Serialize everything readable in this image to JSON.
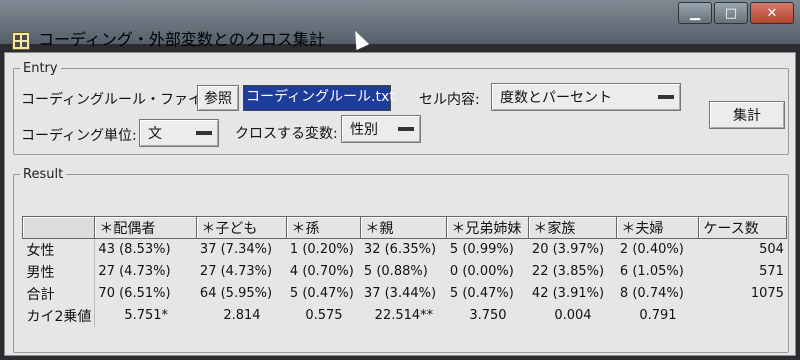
{
  "window": {
    "title": "コーディング・外部変数とのクロス集計",
    "controls": {
      "minimize": "▁",
      "maximize": "□",
      "close": "✕"
    }
  },
  "entry": {
    "legend": "Entry",
    "coding_file_label": "コーディングルール・ファイル:",
    "browse_button": "参照",
    "coding_file_value": "コーディングルール.txt",
    "cell_content_label": "セル内容:",
    "cell_content_value": "度数とパーセント",
    "unit_label": "コーディング単位:",
    "unit_value": "文",
    "cross_var_label": "クロスする変数:",
    "cross_var_value": "性別",
    "aggregate_button": "集計"
  },
  "result": {
    "legend": "Result",
    "columns": [
      "＊配偶者",
      "＊子ども",
      "＊孫",
      "＊親",
      "＊兄弟姉妹",
      "＊家族",
      "＊夫婦",
      "ケース数"
    ],
    "rows": [
      {
        "label": "女性",
        "cells": [
          [
            "43",
            "(8.53%)"
          ],
          [
            "37",
            "(7.34%)"
          ],
          [
            "1",
            "(0.20%)"
          ],
          [
            "32",
            "(6.35%)"
          ],
          [
            "5",
            "(0.99%)"
          ],
          [
            "20",
            "(3.97%)"
          ],
          [
            "2",
            "(0.40%)"
          ]
        ],
        "cases": "504"
      },
      {
        "label": "男性",
        "cells": [
          [
            "27",
            "(4.73%)"
          ],
          [
            "27",
            "(4.73%)"
          ],
          [
            "4",
            "(0.70%)"
          ],
          [
            "5",
            "(0.88%)"
          ],
          [
            "0",
            "(0.00%)"
          ],
          [
            "22",
            "(3.85%)"
          ],
          [
            "6",
            "(1.05%)"
          ]
        ],
        "cases": "571"
      },
      {
        "label": "合計",
        "cells": [
          [
            "70",
            "(6.51%)"
          ],
          [
            "64",
            "(5.95%)"
          ],
          [
            "5",
            "(0.47%)"
          ],
          [
            "37",
            "(3.44%)"
          ],
          [
            "5",
            "(0.47%)"
          ],
          [
            "42",
            "(3.91%)"
          ],
          [
            "8",
            "(0.74%)"
          ]
        ],
        "cases": "1075"
      }
    ],
    "chi_label": "カイ2乗値",
    "chi_values": [
      "5.751*",
      "2.814",
      "0.575",
      "22.514**",
      "3.750",
      "0.004",
      "0.791"
    ]
  }
}
